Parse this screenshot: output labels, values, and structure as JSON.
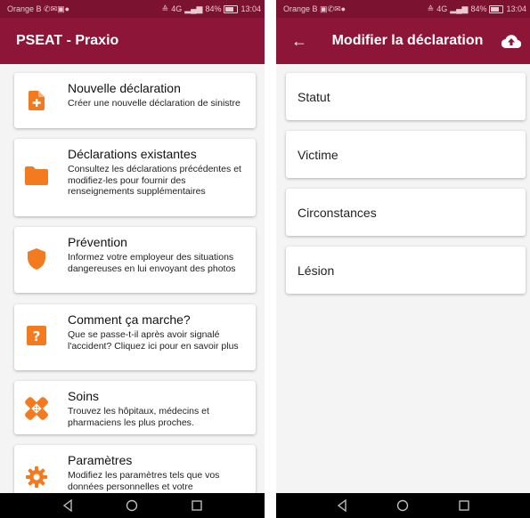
{
  "status_bar": {
    "carrier": "Orange B",
    "signal_info": "4G",
    "battery": "84%",
    "time": "13:04"
  },
  "left_screen": {
    "title": "PSEAT - Praxio",
    "cards": [
      {
        "icon": "file-plus-icon",
        "title": "Nouvelle déclaration",
        "description": "Créer une nouvelle déclaration de sinistre"
      },
      {
        "icon": "folder-icon",
        "title": "Déclarations existantes",
        "description": "Consultez les déclarations précédentes et modifiez-les pour fournir des renseignements supplémentaires"
      },
      {
        "icon": "shield-icon",
        "title": "Prévention",
        "description": "Informez votre employeur des situations dangereuses en lui envoyant des photos"
      },
      {
        "icon": "help-icon",
        "title": "Comment ça marche?",
        "description": "Que se passe-t-il après avoir signalé l'accident? Cliquez ici pour en savoir plus"
      },
      {
        "icon": "bandage-icon",
        "title": "Soins",
        "description": "Trouvez les hôpitaux, médecins et pharmaciens les plus proches."
      },
      {
        "icon": "gear-icon",
        "title": "Paramètres",
        "description": "Modifiez les paramètres tels que vos données personnelles et votre"
      }
    ]
  },
  "right_screen": {
    "title": "Modifier la déclaration",
    "sections": [
      {
        "label": "Statut"
      },
      {
        "label": "Victime"
      },
      {
        "label": "Circonstances"
      },
      {
        "label": "Lésion"
      }
    ]
  },
  "colors": {
    "status_bar": "#7a1230",
    "app_bar": "#8c1538",
    "accent": "#f47a1f",
    "nav_bar": "#000000",
    "background": "#f4f4f4"
  }
}
